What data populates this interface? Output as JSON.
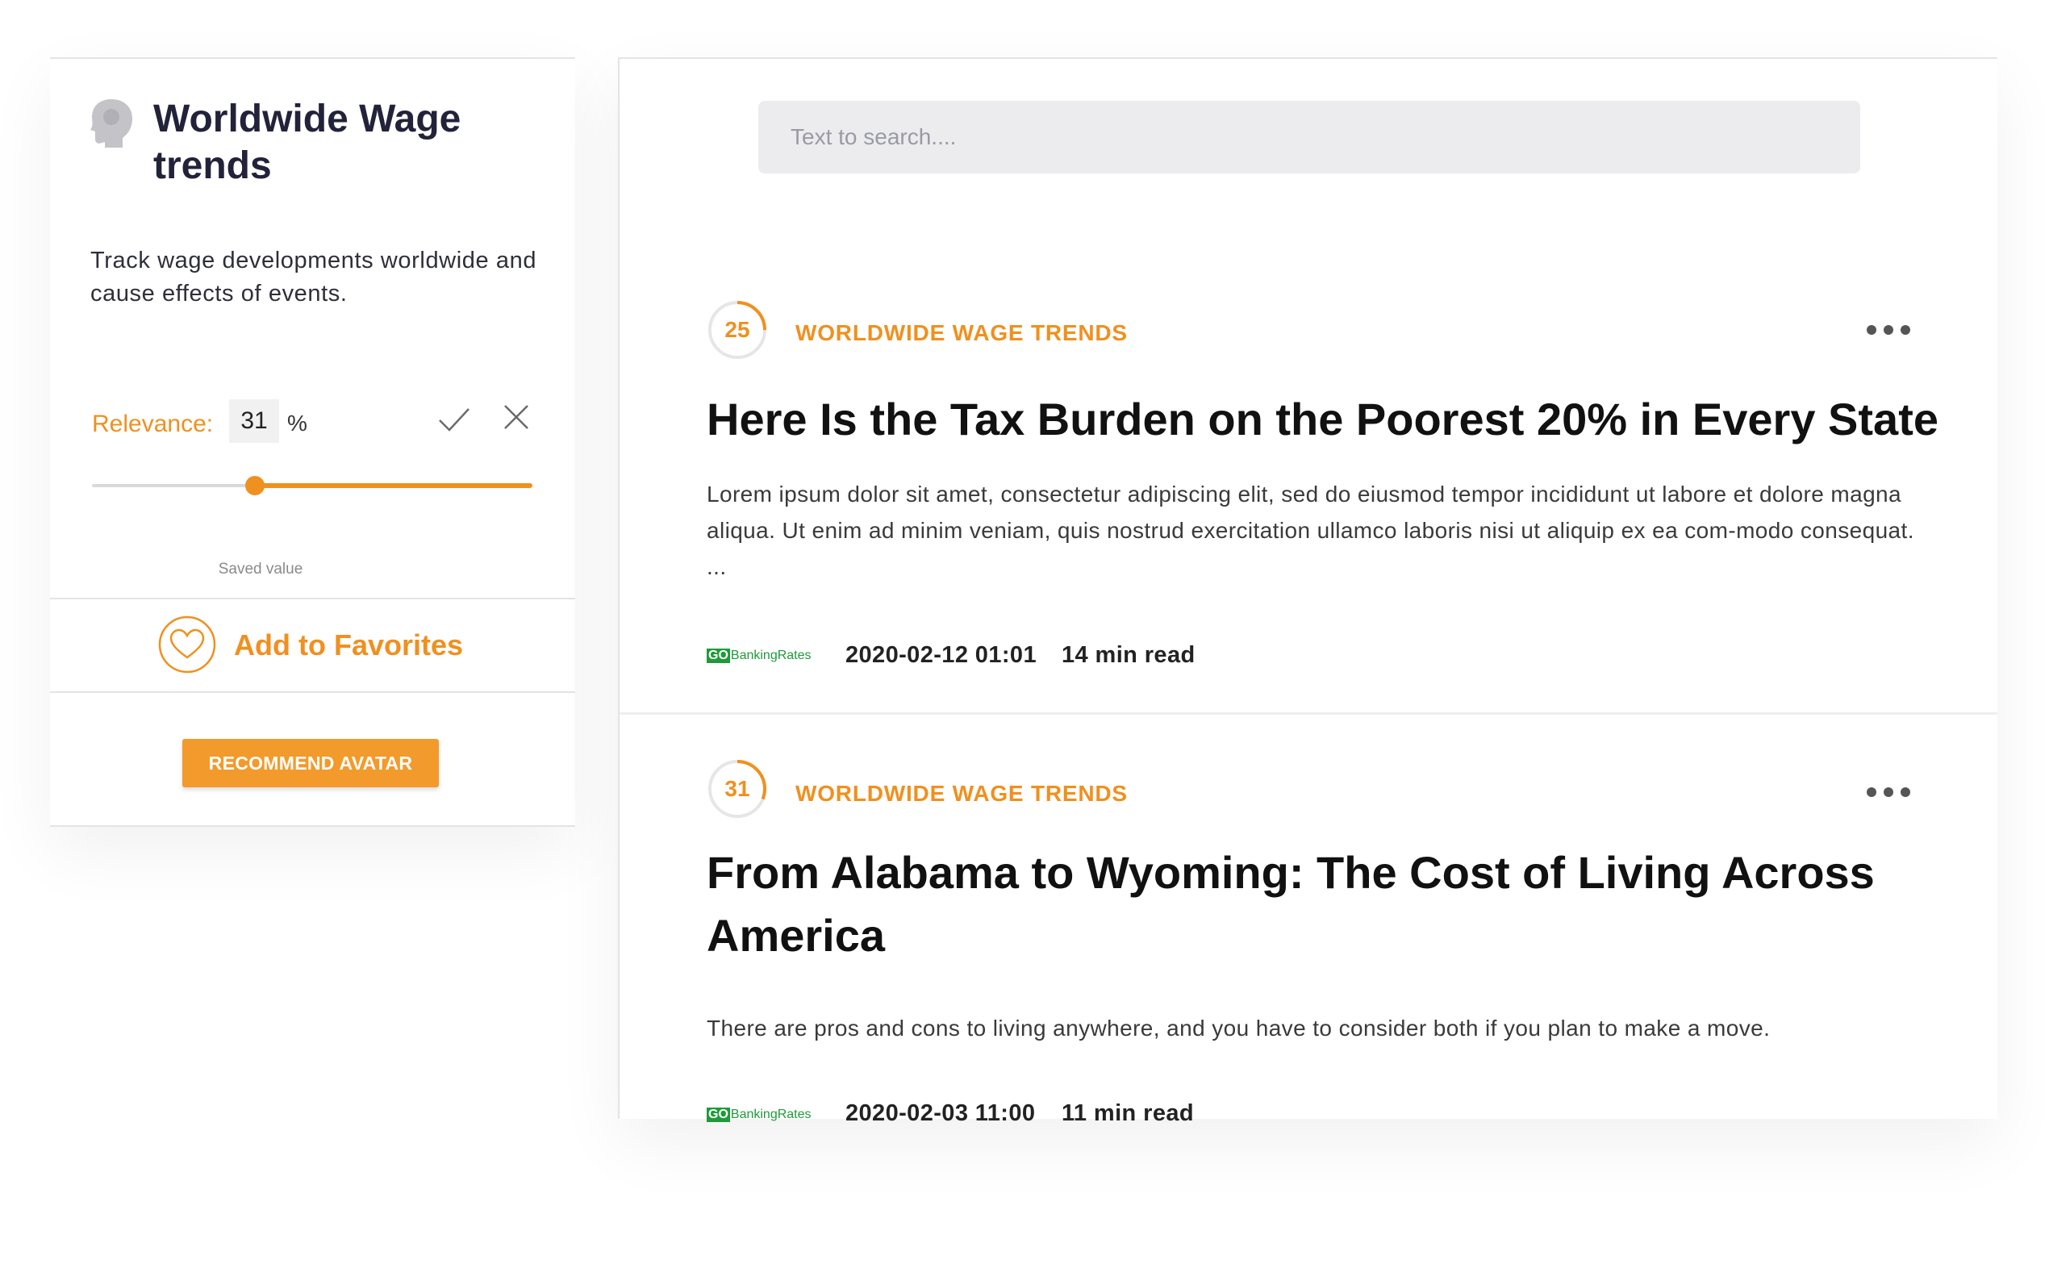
{
  "topic": {
    "avatar_icon": "head-profile-icon",
    "title": "Worldwide Wage trends",
    "description": "Track wage developments worldwide and cause effects of events.",
    "relevance": {
      "label": "Relevance:",
      "value": "31",
      "unit": "%",
      "slider_fraction": 0.37,
      "saved_caption": "Saved value",
      "confirm_icon": "check-icon",
      "cancel_icon": "close-icon"
    },
    "favorites": {
      "icon": "heart-icon",
      "label": "Add to Favorites"
    },
    "recommend_button": "RECOMMEND AVATAR"
  },
  "search": {
    "placeholder": "Text to search...."
  },
  "articles": [
    {
      "score": "25",
      "score_fraction": 0.25,
      "topic_tag": "WORLDWIDE WAGE TRENDS",
      "title": "Here Is the Tax Burden on the Poorest 20% in Every State",
      "excerpt": "Lorem ipsum dolor sit amet, consectetur adipiscing elit, sed do eiusmod tempor incididunt ut labore et dolore magna aliqua. Ut enim ad minim veniam, quis nostrud exercitation ullamco laboris nisi ut aliquip ex ea com-modo consequat. ...",
      "source_go": "GO",
      "source_name": "BankingRates",
      "date": "2020-02-12 01:01",
      "read_time": "14 min read"
    },
    {
      "score": "31",
      "score_fraction": 0.31,
      "topic_tag": "WORLDWIDE WAGE TRENDS",
      "title": "From Alabama to Wyoming: The Cost of Living Across America",
      "excerpt": "There are pros and cons to living anywhere, and you have to consider both if you plan to make a move.",
      "source_go": "GO",
      "source_name": "BankingRates",
      "date": "2020-02-03 11:00",
      "read_time": "11 min read"
    }
  ],
  "colors": {
    "accent": "#f0901f",
    "button": "#f39a2c",
    "source_green": "#1f9a3a"
  }
}
